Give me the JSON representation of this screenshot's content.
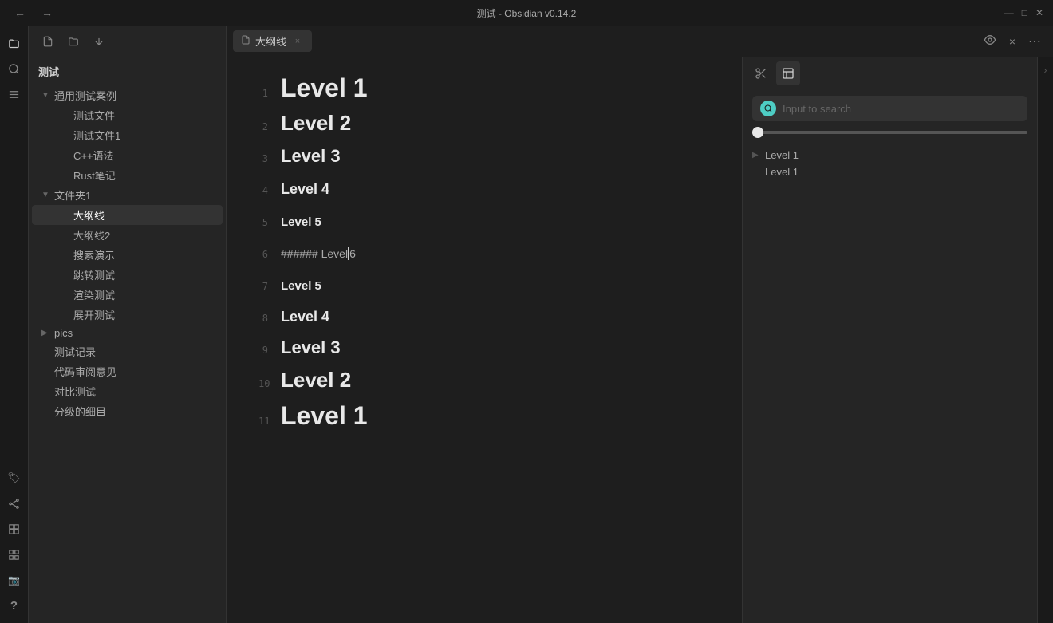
{
  "titlebar": {
    "title": "测试 - Obsidian v0.14.2",
    "nav_back": "←",
    "nav_forward": "→",
    "win_min": "—",
    "win_restore": "□",
    "win_close": "✕"
  },
  "ribbon": {
    "items": [
      {
        "id": "folder-icon",
        "glyph": "📁",
        "label": "folder"
      },
      {
        "id": "search-icon",
        "glyph": "🔍",
        "label": "search"
      },
      {
        "id": "list-icon",
        "glyph": "☰",
        "label": "list"
      }
    ],
    "bottom_items": [
      {
        "id": "tag-icon",
        "glyph": "🏷",
        "label": "tags"
      },
      {
        "id": "graph-icon",
        "glyph": "⬡",
        "label": "graph"
      },
      {
        "id": "plugin-icon",
        "glyph": "🧩",
        "label": "plugins"
      },
      {
        "id": "grid-icon",
        "glyph": "⊞",
        "label": "grid"
      },
      {
        "id": "camera-icon",
        "glyph": "📷",
        "label": "camera"
      },
      {
        "id": "help-icon",
        "glyph": "?",
        "label": "help"
      }
    ]
  },
  "sidebar": {
    "vault_name": "测试",
    "header_btns": [
      "📄",
      "📁",
      "↕"
    ],
    "tree": [
      {
        "level": 0,
        "type": "folder",
        "label": "通用测试案例",
        "expanded": true,
        "arrow": "▼"
      },
      {
        "level": 1,
        "type": "file",
        "label": "测试文件",
        "active": false
      },
      {
        "level": 1,
        "type": "file",
        "label": "测试文件1",
        "active": false
      },
      {
        "level": 1,
        "type": "file",
        "label": "C++语法",
        "active": false
      },
      {
        "level": 1,
        "type": "file",
        "label": "Rust笔记",
        "active": false
      },
      {
        "level": 0,
        "type": "folder",
        "label": "文件夹1",
        "expanded": true,
        "arrow": "▼"
      },
      {
        "level": 1,
        "type": "file",
        "label": "大纲线",
        "active": true
      },
      {
        "level": 1,
        "type": "file",
        "label": "大纲线2",
        "active": false
      },
      {
        "level": 1,
        "type": "file",
        "label": "搜索演示",
        "active": false
      },
      {
        "level": 1,
        "type": "file",
        "label": "跳转测试",
        "active": false
      },
      {
        "level": 1,
        "type": "file",
        "label": "渲染测试",
        "active": false
      },
      {
        "level": 1,
        "type": "file",
        "label": "展开测试",
        "active": false
      },
      {
        "level": 0,
        "type": "folder",
        "label": "pics",
        "expanded": false,
        "arrow": "▶"
      },
      {
        "level": 0,
        "type": "file",
        "label": "测试记录",
        "active": false
      },
      {
        "level": 0,
        "type": "file",
        "label": "代码审阅意见",
        "active": false
      },
      {
        "level": 0,
        "type": "file",
        "label": "对比测试",
        "active": false
      },
      {
        "level": 0,
        "type": "file",
        "label": "分级的细目",
        "active": false
      }
    ]
  },
  "tab": {
    "icon": "📄",
    "label": "大纲线",
    "close": "×",
    "actions": [
      "👓",
      "×",
      "⋮"
    ]
  },
  "editor": {
    "lines": [
      {
        "num": "1",
        "text": "Level 1",
        "size": "h1"
      },
      {
        "num": "2",
        "text": "Level 2",
        "size": "h2"
      },
      {
        "num": "3",
        "text": "Level 3",
        "size": "h3"
      },
      {
        "num": "4",
        "text": "Level 4",
        "size": "h4"
      },
      {
        "num": "5",
        "text": "Level 5",
        "size": "h5"
      },
      {
        "num": "6",
        "text": "###### Level 6",
        "size": "h6-raw"
      },
      {
        "num": "7",
        "text": "Level 5",
        "size": "h5"
      },
      {
        "num": "8",
        "text": "Level 4",
        "size": "h4"
      },
      {
        "num": "9",
        "text": "Level 3",
        "size": "h3"
      },
      {
        "num": "10",
        "text": "Level 2",
        "size": "h2"
      },
      {
        "num": "11",
        "text": "Level 1",
        "size": "h1"
      }
    ]
  },
  "right_panel": {
    "header_btns": [
      {
        "id": "scissors-icon",
        "glyph": "✂",
        "active": false
      },
      {
        "id": "panel-icon",
        "glyph": "⬜",
        "active": true
      }
    ],
    "search": {
      "placeholder": "Input to search",
      "icon": "↺"
    },
    "outline": {
      "items": [
        {
          "label": "Level 1",
          "has_arrow": true
        },
        {
          "label": "Level 1",
          "has_arrow": false
        }
      ]
    }
  }
}
